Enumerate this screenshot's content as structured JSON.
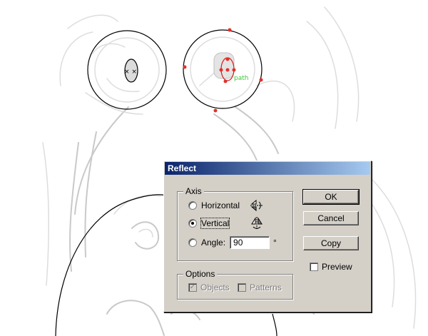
{
  "canvas": {
    "path_label": "path",
    "anchor_color": "#e3302b",
    "guide_color": "#3cc53c"
  },
  "dialog": {
    "title": "Reflect",
    "axis": {
      "legend": "Axis",
      "horizontal_label": "Horizontal",
      "vertical_label": "Vertical",
      "angle_label": "Angle:",
      "angle_value": "90",
      "degree_symbol": "°",
      "selected": "vertical",
      "horizontal_icon": "reflect-horizontal-icon",
      "vertical_icon": "reflect-vertical-icon"
    },
    "options": {
      "legend": "Options",
      "objects_label": "Objects",
      "objects_checked": true,
      "patterns_label": "Patterns",
      "patterns_checked": false
    },
    "buttons": {
      "ok": "OK",
      "cancel": "Cancel",
      "copy": "Copy"
    },
    "preview": {
      "label": "Preview",
      "checked": false
    }
  }
}
